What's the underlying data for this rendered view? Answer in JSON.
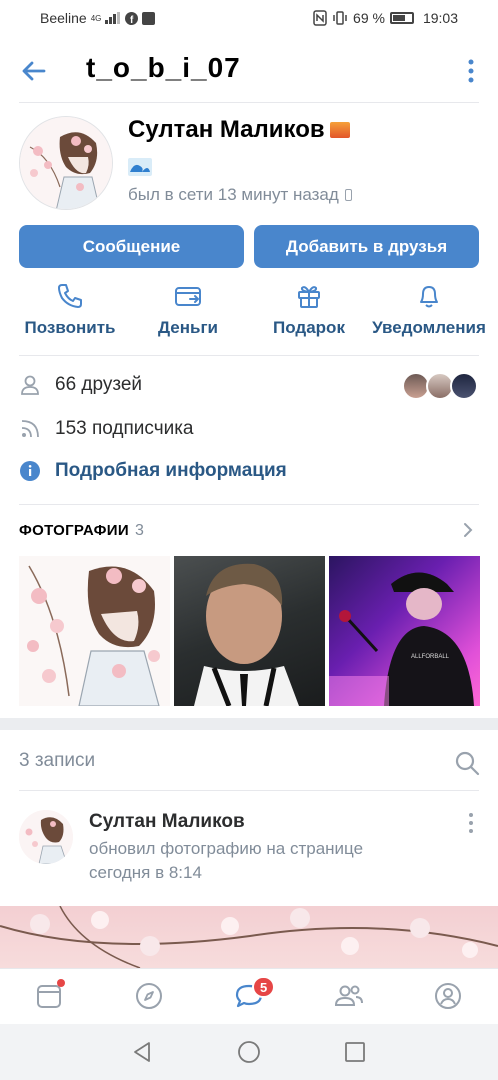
{
  "status_bar": {
    "carrier": "Beeline",
    "network": "4G",
    "battery": "69 %",
    "time": "19:03"
  },
  "header": {
    "username": "t_o_b_i_07",
    "back_icon": "arrow-left-icon",
    "menu_icon": "more-vertical-icon"
  },
  "profile": {
    "name": "Султан Маликов",
    "status_emoji": "sunrise-emoji",
    "status_text_emoji": "wave-emoji",
    "online": "был в сети 13 минут назад"
  },
  "buttons": {
    "message": "Сообщение",
    "add_friend": "Добавить в друзья"
  },
  "actions": [
    {
      "label": "Позвонить",
      "icon": "phone-icon"
    },
    {
      "label": "Деньги",
      "icon": "money-transfer-icon"
    },
    {
      "label": "Подарок",
      "icon": "gift-icon"
    },
    {
      "label": "Уведомления",
      "icon": "bell-icon"
    }
  ],
  "info": {
    "friends": "66 друзей",
    "followers": "153 подписчика",
    "details": "Подробная информация"
  },
  "photos": {
    "title": "ФОТОГРАФИИ",
    "count": "3"
  },
  "posts": {
    "title": "3 записи",
    "author": "Султан Маликов",
    "action": "обновил фотографию на странице",
    "time": "сегодня в 8:14"
  },
  "tabbar": {
    "messages_badge": "5",
    "items": [
      "news-icon",
      "discover-icon",
      "messages-icon",
      "friends-icon",
      "profile-icon"
    ]
  },
  "colors": {
    "accent": "#4986cc",
    "link": "#2a5885",
    "secondary": "#818c99",
    "badge": "#e64646"
  }
}
